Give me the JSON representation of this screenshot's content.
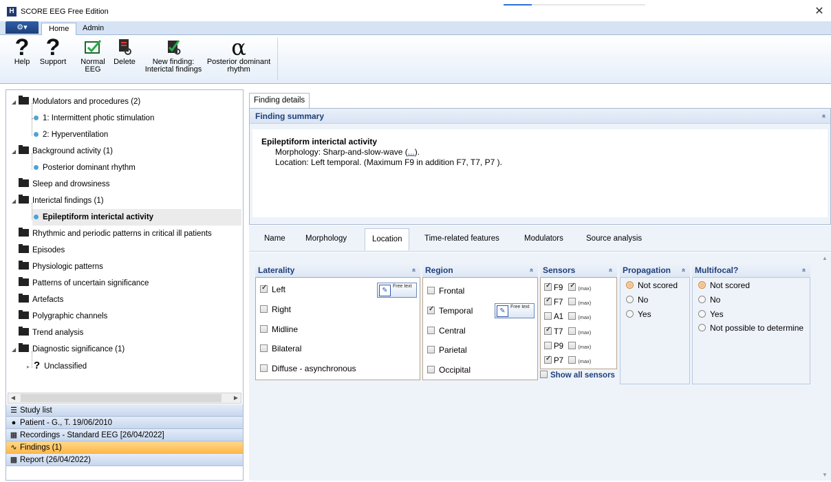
{
  "window": {
    "title": "SCORE EEG Free Edition",
    "app_icon_letter": "H",
    "close_glyph": "✕",
    "progress_fraction": 0.2
  },
  "ribbon": {
    "app_menu_label": "⚙▾",
    "tabs": [
      "Home",
      "Admin"
    ],
    "buttons": {
      "help": "Help",
      "support": "Support",
      "normal_eeg": "Normal EEG",
      "delete": "Delete",
      "new_finding": "New finding: Interictal findings",
      "pdr": "Posterior dominant rhythm"
    },
    "icons": {
      "help": "?",
      "support": "?",
      "alpha": "α"
    }
  },
  "tree": {
    "items": [
      {
        "label": "Modulators and procedures  (2)",
        "type": "folder"
      },
      {
        "label": "1: Intermittent photic stimulation",
        "type": "leaf"
      },
      {
        "label": "2: Hyperventilation",
        "type": "leaf"
      },
      {
        "label": "Background activity  (1)",
        "type": "folder"
      },
      {
        "label": "Posterior dominant rhythm",
        "type": "leaf"
      },
      {
        "label": "Sleep and drowsiness",
        "type": "folder"
      },
      {
        "label": "Interictal findings  (1)",
        "type": "folder"
      },
      {
        "label": "Epileptiform interictal activity",
        "type": "leaf"
      },
      {
        "label": "Rhythmic and periodic patterns in critical ill patients",
        "type": "folder"
      },
      {
        "label": "Episodes",
        "type": "folder"
      },
      {
        "label": "Physiologic patterns",
        "type": "folder"
      },
      {
        "label": "Patterns of uncertain significance",
        "type": "folder"
      },
      {
        "label": "Artefacts",
        "type": "folder"
      },
      {
        "label": "Polygraphic channels",
        "type": "folder"
      },
      {
        "label": "Trend analysis",
        "type": "folder"
      },
      {
        "label": "Diagnostic significance  (1)",
        "type": "folder"
      },
      {
        "label": "Unclassified",
        "type": "question"
      }
    ],
    "question_glyph": "?"
  },
  "navbars": {
    "study_list": "Study list",
    "patient": "Patient - G., T. 19/06/2010",
    "recordings": "Recordings - Standard EEG [26/04/2022]",
    "findings": "Findings (1)",
    "report": "Report (26/04/2022)"
  },
  "details": {
    "tab": "Finding details",
    "summary_header": "Finding summary",
    "summary_title": "Epileptiform interictal activity",
    "morphology_prefix": "Morphology: Sharp-and-slow-wave (",
    "morphology_link": "...",
    "morphology_suffix": ").",
    "location_line": "Location:  Left temporal. (Maximum F9 in addition F7, T7, P7 )."
  },
  "subtabs": [
    "Name",
    "Morphology",
    "Location",
    "Time-related features",
    "Modulators",
    "Source analysis"
  ],
  "collapse_glyph": "»",
  "free_text_label": "Free text",
  "laterality": {
    "header": "Laterality",
    "options": [
      {
        "label": "Left",
        "checked": true
      },
      {
        "label": "Right",
        "checked": false
      },
      {
        "label": "Midline",
        "checked": false
      },
      {
        "label": "Bilateral",
        "checked": false
      },
      {
        "label": "Diffuse - asynchronous",
        "checked": false
      }
    ]
  },
  "region": {
    "header": "Region",
    "options": [
      {
        "label": "Frontal",
        "checked": false
      },
      {
        "label": "Temporal",
        "checked": true
      },
      {
        "label": "Central",
        "checked": false
      },
      {
        "label": "Parietal",
        "checked": false
      },
      {
        "label": "Occipital",
        "checked": false
      }
    ]
  },
  "sensors": {
    "header": "Sensors",
    "max_label": "(max)",
    "items": [
      {
        "name": "F9",
        "checked": true,
        "max": true
      },
      {
        "name": "F7",
        "checked": true,
        "max": false
      },
      {
        "name": "A1",
        "checked": false,
        "max": false
      },
      {
        "name": "T7",
        "checked": true,
        "max": false
      },
      {
        "name": "P9",
        "checked": false,
        "max": false
      },
      {
        "name": "P7",
        "checked": true,
        "max": false
      }
    ],
    "show_all": "Show all sensors"
  },
  "propagation": {
    "header": "Propagation",
    "options": [
      {
        "label": "Not scored",
        "selected": true
      },
      {
        "label": "No",
        "selected": false
      },
      {
        "label": "Yes",
        "selected": false
      }
    ]
  },
  "multifocal": {
    "header": "Multifocal?",
    "options": [
      {
        "label": "Not scored",
        "selected": true
      },
      {
        "label": "No",
        "selected": false
      },
      {
        "label": "Yes",
        "selected": false
      },
      {
        "label": "Not possible to determine",
        "selected": false
      }
    ]
  }
}
